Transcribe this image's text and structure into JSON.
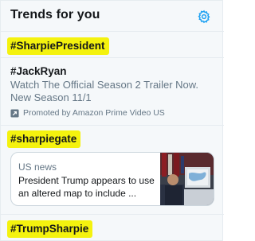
{
  "header": {
    "title": "Trends for you",
    "settings_icon": "gear-icon"
  },
  "trends": [
    {
      "hashtag": "#SharpiePresident",
      "highlight": "#f4f20e"
    },
    {
      "promoted": {
        "hashtag": "#JackRyan",
        "description": "Watch The Official Season 2 Trailer Now. New Season 11/1",
        "promoted_by": "Promoted by Amazon Prime Video US",
        "icon": "promoted-icon"
      }
    },
    {
      "hashtag": "#sharpiegate",
      "highlight": "#f4f20e",
      "news_card": {
        "source": "US news",
        "headline": "President Trump appears to use an altered map to include ...",
        "thumbnail_icon": "news-thumbnail-image"
      }
    },
    {
      "hashtag": "#TrumpSharpie",
      "highlight": "#f4f20e"
    }
  ],
  "colors": {
    "accent": "#1da1f2",
    "secondary_text": "#657786",
    "panel_bg": "#f5f8fa",
    "border": "#e6ecf0"
  }
}
